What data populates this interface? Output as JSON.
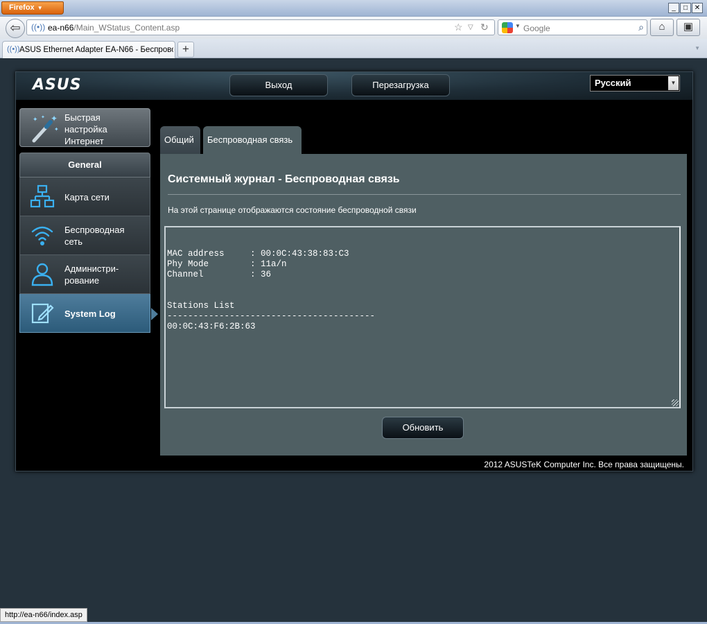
{
  "browser": {
    "app_button": "Firefox",
    "window_controls": [
      "_",
      "□",
      "✕"
    ],
    "url_host": "ea-n66",
    "url_path": "/Main_WStatus_Content.asp",
    "search_placeholder": "Google",
    "tab_title": "ASUS Ethernet Adapter EA-N66 - Беспрово...",
    "new_tab": "+",
    "status_url": "http://ea-n66/index.asp"
  },
  "header": {
    "logout_label": "Выход",
    "reboot_label": "Перезагрузка",
    "language": "Русский"
  },
  "sidebar": {
    "quick_setup": "Быстрая настройка Интернет",
    "general_header": "General",
    "items": [
      {
        "label": "Карта сети",
        "icon": "network-map-icon"
      },
      {
        "label": "Беспроводная сеть",
        "icon": "wireless-icon"
      },
      {
        "label": "Администри-рование",
        "icon": "admin-user-icon"
      },
      {
        "label": "System Log",
        "icon": "system-log-icon",
        "active": true
      }
    ]
  },
  "tabs": [
    {
      "label": "Общий",
      "active": false
    },
    {
      "label": "Беспроводная связь",
      "active": true
    }
  ],
  "main": {
    "title": "Системный журнал - Беспроводная связь",
    "description": "На этой странице отображаются состояние беспроводной связи",
    "log_text": "MAC address     : 00:0C:43:38:83:C3\nPhy Mode        : 11a/n\nChannel         : 36\n\n\nStations List\n----------------------------------------\n00:0C:43:F6:2B:63",
    "refresh_label": "Обновить"
  },
  "footer": {
    "copyright": "2012 ASUSTeK Computer Inc. Все права защищены."
  },
  "colors": {
    "page_bg": "#25323c",
    "panel_bg": "#4f5f63",
    "active_menu": "#4f7d9c",
    "firefox_orange": "#e8761c"
  }
}
